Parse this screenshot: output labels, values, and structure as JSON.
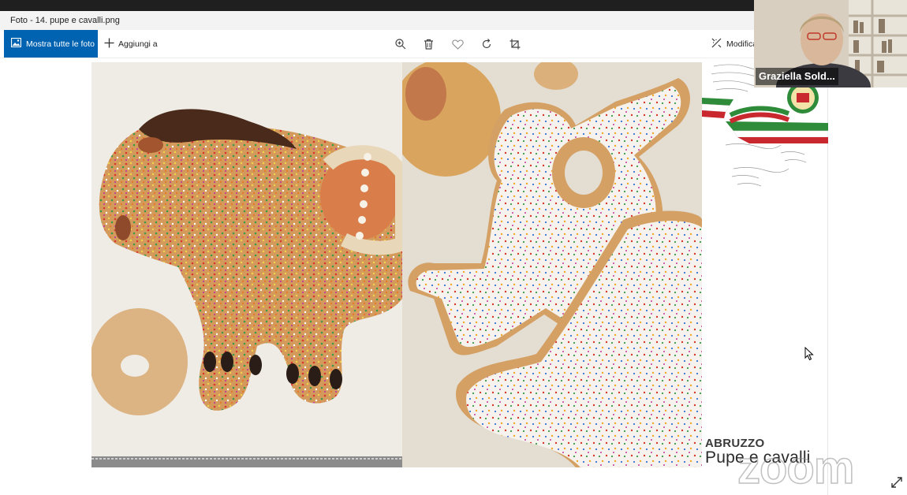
{
  "window": {
    "title": "Foto - 14. pupe e cavalli.png"
  },
  "toolbar": {
    "show_all_label": "Mostra tutte le foto",
    "add_to_label": "Aggiungi a",
    "edit_label": "Modifica",
    "icons": [
      "zoom-in-icon",
      "delete-icon",
      "favorite-icon",
      "rotate-icon",
      "crop-icon"
    ]
  },
  "slide": {
    "region": "ABRUZZO",
    "title": "Pupe e cavalli",
    "watermark": "zoom"
  },
  "participant": {
    "name": "Graziella Sold..."
  },
  "colors": {
    "accent": "#0063b1",
    "flag_green": "#2e8b3a",
    "flag_red": "#c8282e"
  }
}
